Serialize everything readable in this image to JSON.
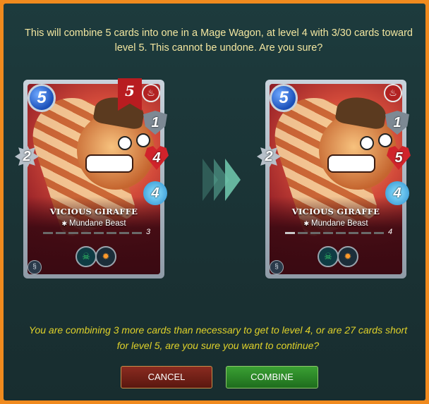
{
  "message": "This will combine 5 cards into one in a Mage Wagon, at level 4 with 3/30 cards toward level 5. This cannot be undone. Are you sure?",
  "cards": [
    {
      "side": "left",
      "name": "VICIOUS GIRAFFE",
      "type": "Mundane Beast",
      "mana": "5",
      "level_banner": "5",
      "armor": "1",
      "health": "4",
      "speed": "4",
      "melee": "2",
      "level_display": "3",
      "progress_fraction": 0.0,
      "element_icon": "fire-icon",
      "abilities": [
        "poison-icon",
        "enrage-icon"
      ]
    },
    {
      "side": "right",
      "name": "VICIOUS GIRAFFE",
      "type": "Mundane Beast",
      "mana": "5",
      "level_banner": "",
      "armor": "1",
      "health": "5",
      "speed": "4",
      "melee": "2",
      "level_display": "4",
      "progress_fraction": 0.1,
      "element_icon": "fire-icon",
      "abilities": [
        "poison-icon",
        "enrage-icon"
      ]
    }
  ],
  "warning": "You are combining 3 more cards than necessary to get to level 4, or are 27 cards short for level 5, are you sure you want to continue?",
  "buttons": {
    "cancel_label": "CANCEL",
    "combine_label": "COMBINE"
  },
  "colors": {
    "border": "#f08a1e",
    "message_text": "#f2e6a0",
    "warning_text": "#e0d22a",
    "cancel_bg": "#6e2015",
    "combine_bg": "#2a8a26"
  }
}
